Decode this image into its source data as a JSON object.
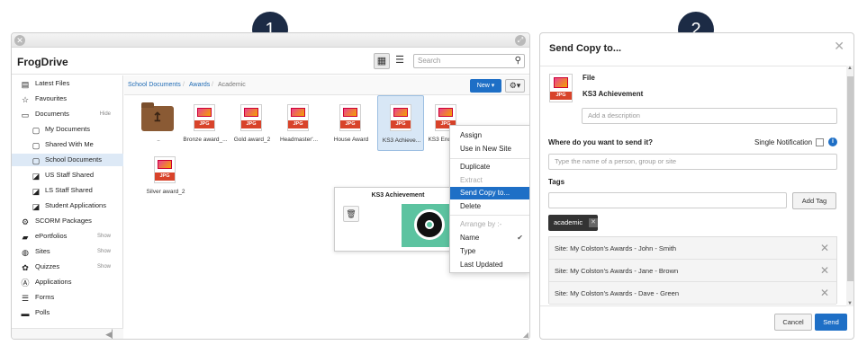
{
  "badges": [
    "1",
    "2"
  ],
  "frogdrive": {
    "title": "FrogDrive",
    "search_placeholder": "Search",
    "sidebar": {
      "latest_files": "Latest Files",
      "favourites": "Favourites",
      "documents": "Documents",
      "documents_tag": "Hide",
      "my_documents": "My Documents",
      "shared_with_me": "Shared With Me",
      "school_documents": "School Documents",
      "us_staff_shared": "US Staff Shared",
      "ls_staff_shared": "LS Staff Shared",
      "student_applications": "Student Applications",
      "scorm_packages": "SCORM Packages",
      "eportfolios": "ePortfolios",
      "eportfolios_tag": "Show",
      "sites": "Sites",
      "sites_tag": "Show",
      "quizzes": "Quizzes",
      "quizzes_tag": "Show",
      "applications": "Applications",
      "forms": "Forms",
      "polls": "Polls"
    },
    "breadcrumb": [
      "School Documents",
      "Awards",
      "Academic"
    ],
    "new_button": "New ▾",
    "files": [
      {
        "name": "..",
        "type": "folder"
      },
      {
        "name": "Bronze award_...",
        "type": "JPG"
      },
      {
        "name": "Gold award_2",
        "type": "JPG"
      },
      {
        "name": "Headmaster'...",
        "type": "JPG"
      },
      {
        "name": "House Award",
        "type": "JPG"
      },
      {
        "name": "KS3 Achieve...",
        "type": "JPG"
      },
      {
        "name": "KS3 Endeav...",
        "type": "JPG"
      },
      {
        "name": "Silver award_2",
        "type": "JPG"
      }
    ],
    "context_menu": {
      "assign": "Assign",
      "use_in_new_site": "Use in New Site",
      "duplicate": "Duplicate",
      "extract": "Extract",
      "send_copy_to": "Send Copy to...",
      "delete": "Delete",
      "arrange_by": "Arrange by :-",
      "name": "Name",
      "type": "Type",
      "last_updated": "Last Updated"
    },
    "preview_title": "KS3 Achievement"
  },
  "dialog": {
    "title": "Send Copy to...",
    "file_label": "File",
    "file_name": "KS3 Achievement",
    "description_placeholder": "Add a description",
    "where_label": "Where do you want to send it?",
    "single_notification": "Single Notification",
    "recipient_placeholder": "Type the name of a person, group or site",
    "tags_label": "Tags",
    "add_tag": "Add Tag",
    "tag_chip": "academic",
    "sites": [
      "Site: My Colston's Awards - John - Smith",
      "Site: My Colston's Awards - Jane - Brown",
      "Site: My Colston's Awards - Dave - Green"
    ],
    "cancel": "Cancel",
    "send": "Send"
  }
}
